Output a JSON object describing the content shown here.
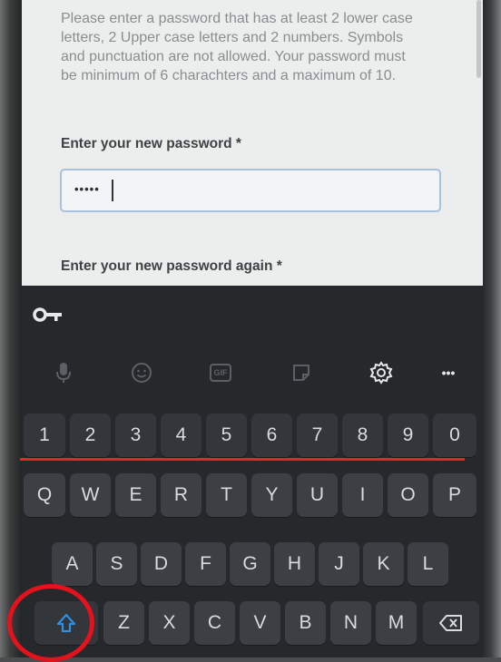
{
  "page": {
    "instructions": [
      "Please enter a password that has at least 2 lower case",
      "letters, 2 Upper case letters and 2 numbers. Symbols",
      "and punctuation are not allowed. Your password must",
      "be minimum of 6 charachters and a maximum of 10."
    ],
    "new_password_label": "Enter your new password *",
    "password_mask": "•••••",
    "again_label": "Enter your new password again *"
  },
  "keyboard": {
    "toolbar": [
      "microphone-icon",
      "emoji-icon",
      "gif-icon",
      "sticker-icon",
      "settings-icon",
      "more-icon"
    ],
    "gif_label": "GIF",
    "more_label": "•••",
    "number_row": [
      "1",
      "2",
      "3",
      "4",
      "5",
      "6",
      "7",
      "8",
      "9",
      "0"
    ],
    "row1": [
      "Q",
      "W",
      "E",
      "R",
      "T",
      "Y",
      "U",
      "I",
      "O",
      "P"
    ],
    "row2": [
      "A",
      "S",
      "D",
      "F",
      "G",
      "H",
      "J",
      "K",
      "L"
    ],
    "row3": [
      "Z",
      "X",
      "C",
      "V",
      "B",
      "N",
      "M"
    ]
  },
  "annotations": {
    "underline_color": "#e0262a",
    "circle_color": "#e3121c"
  }
}
